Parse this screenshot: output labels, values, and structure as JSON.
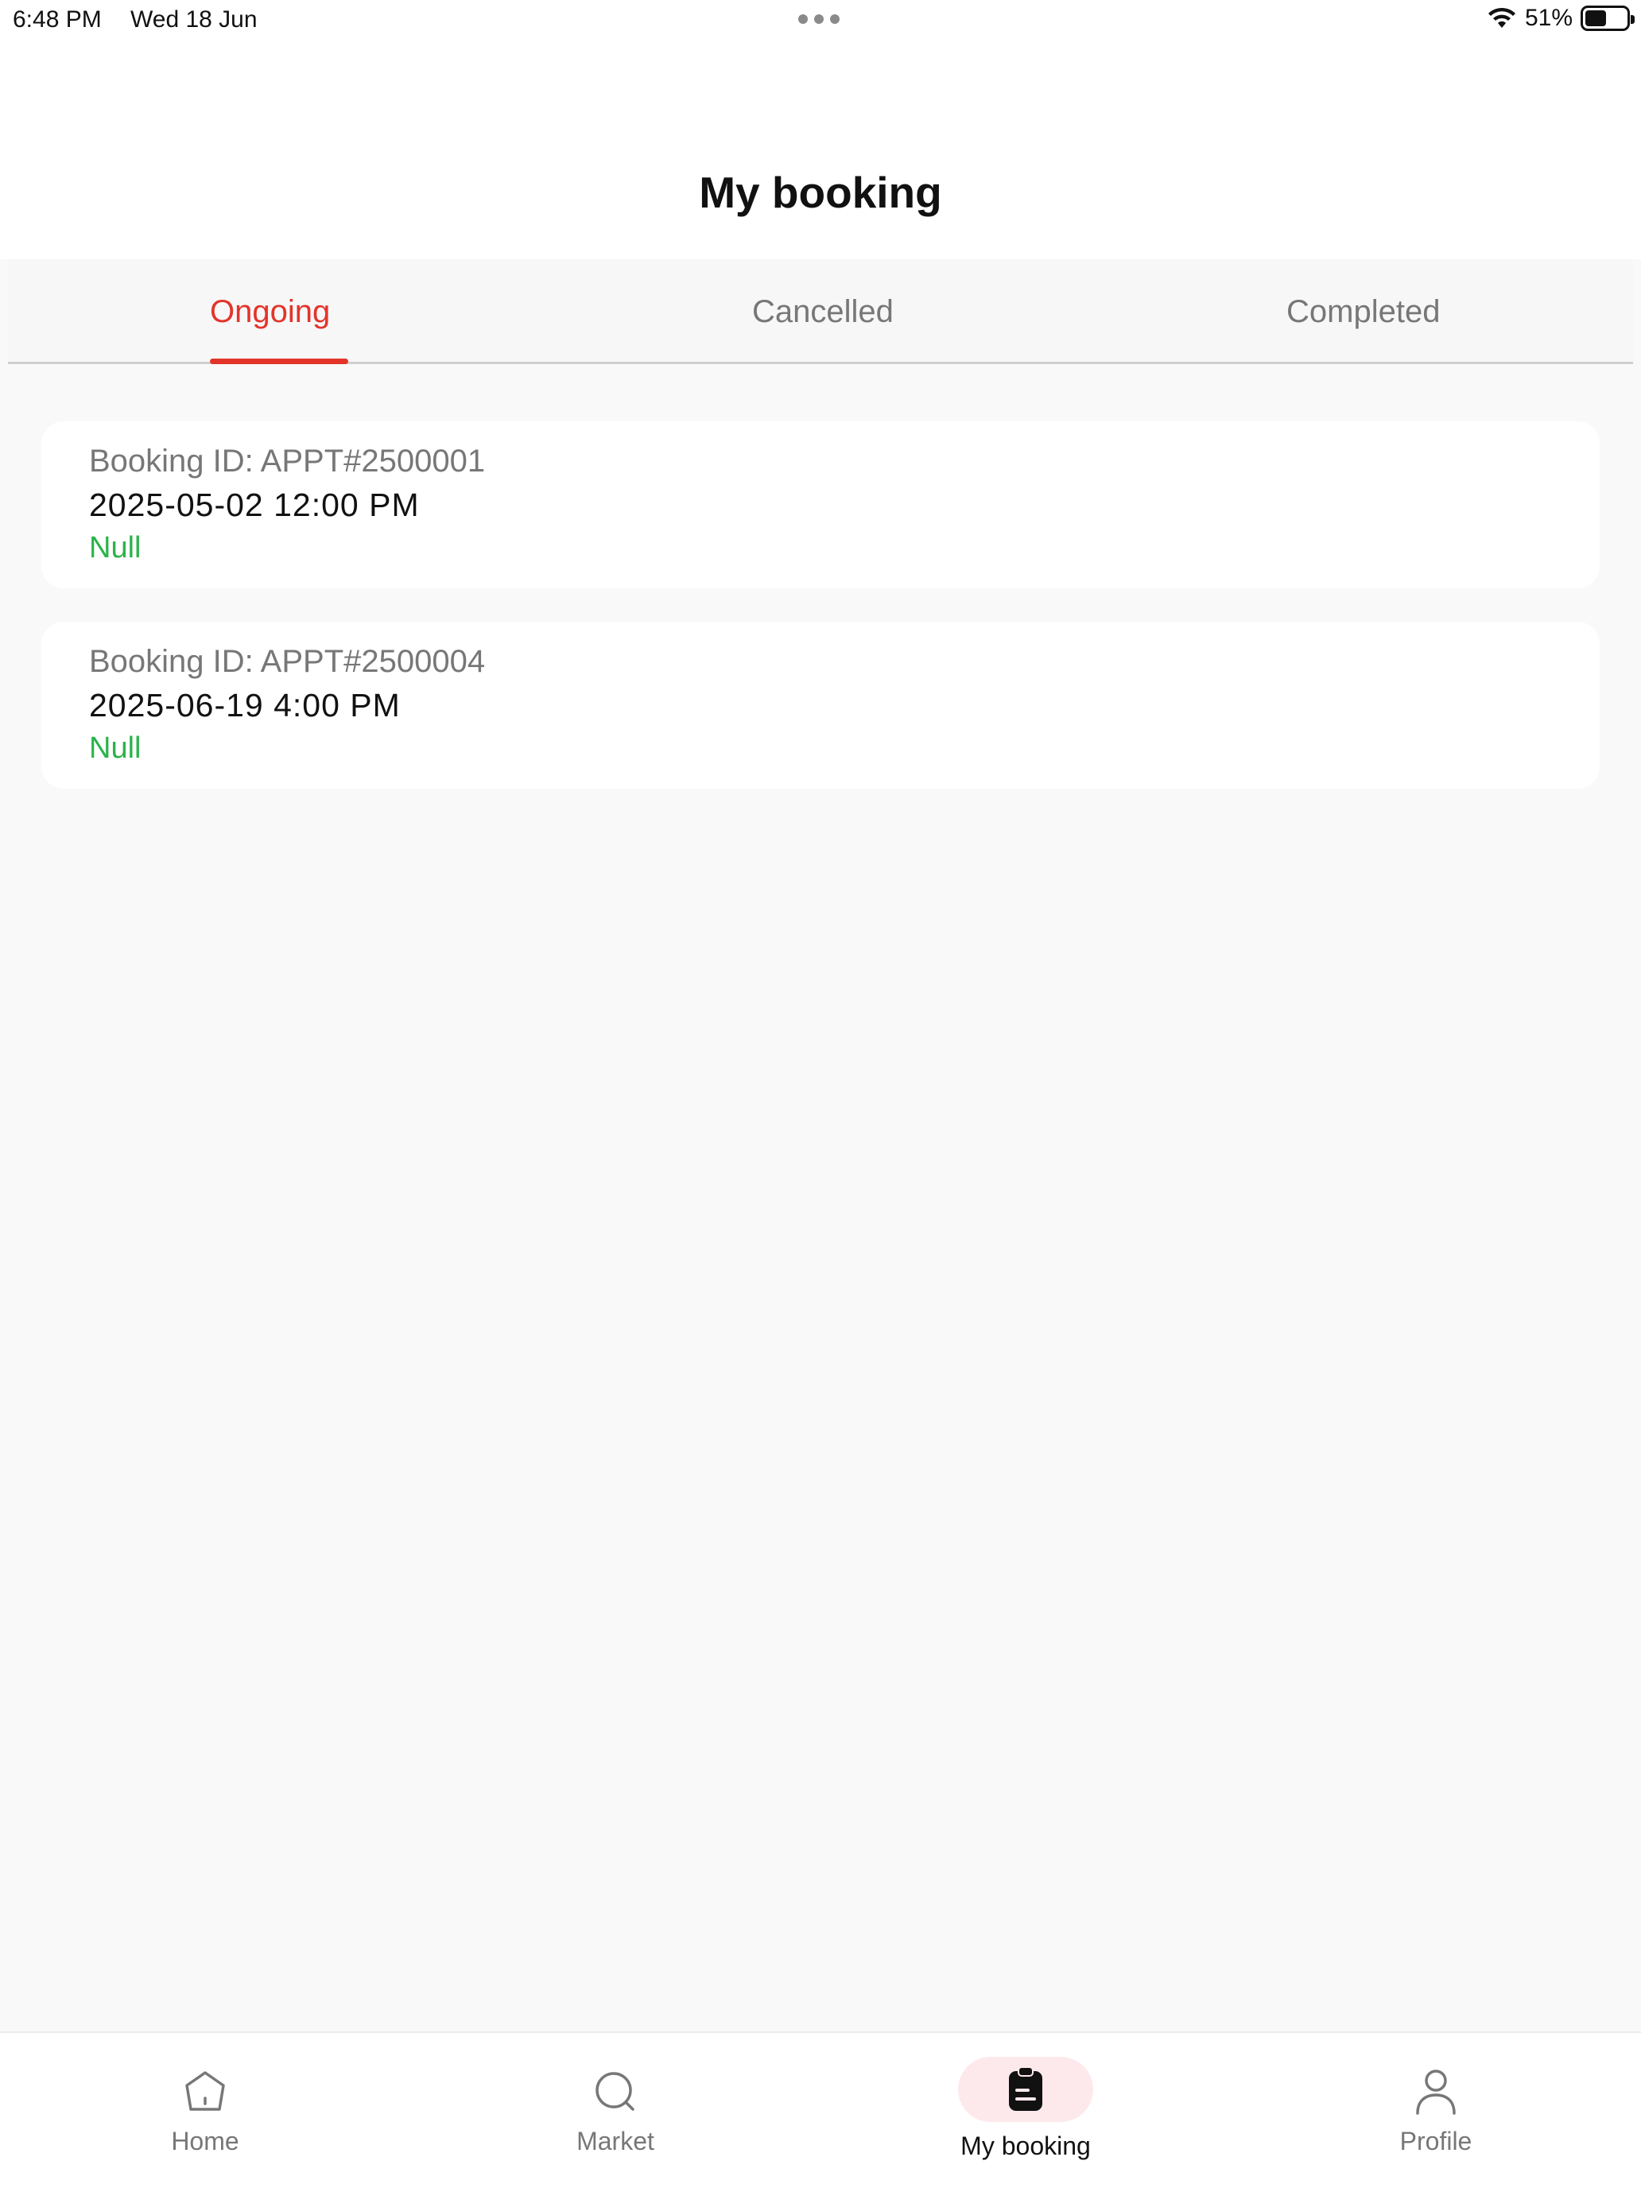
{
  "status_bar": {
    "time": "6:48 PM",
    "date": "Wed 18 Jun",
    "battery": "51%",
    "battery_level": 0.51
  },
  "header": {
    "title": "My booking"
  },
  "tabs": [
    {
      "label": "Ongoing",
      "active": true
    },
    {
      "label": "Cancelled",
      "active": false
    },
    {
      "label": "Completed",
      "active": false
    }
  ],
  "bookings": [
    {
      "id": "Booking ID: APPT#2500001",
      "datetime": "2025-05-02 12:00 PM",
      "status": "Null"
    },
    {
      "id": "Booking ID: APPT#2500004",
      "datetime": "2025-06-19 4:00 PM",
      "status": "Null"
    }
  ],
  "bottom_nav": [
    {
      "label": "Home",
      "icon": "home-icon",
      "active": false
    },
    {
      "label": "Market",
      "icon": "search-icon",
      "active": false
    },
    {
      "label": "My booking",
      "icon": "clipboard-icon",
      "active": true
    },
    {
      "label": "Profile",
      "icon": "person-icon",
      "active": false
    }
  ],
  "colors": {
    "accent": "#e3342a",
    "status_green": "#2bb34a",
    "active_nav_bg": "#fde9ec"
  }
}
